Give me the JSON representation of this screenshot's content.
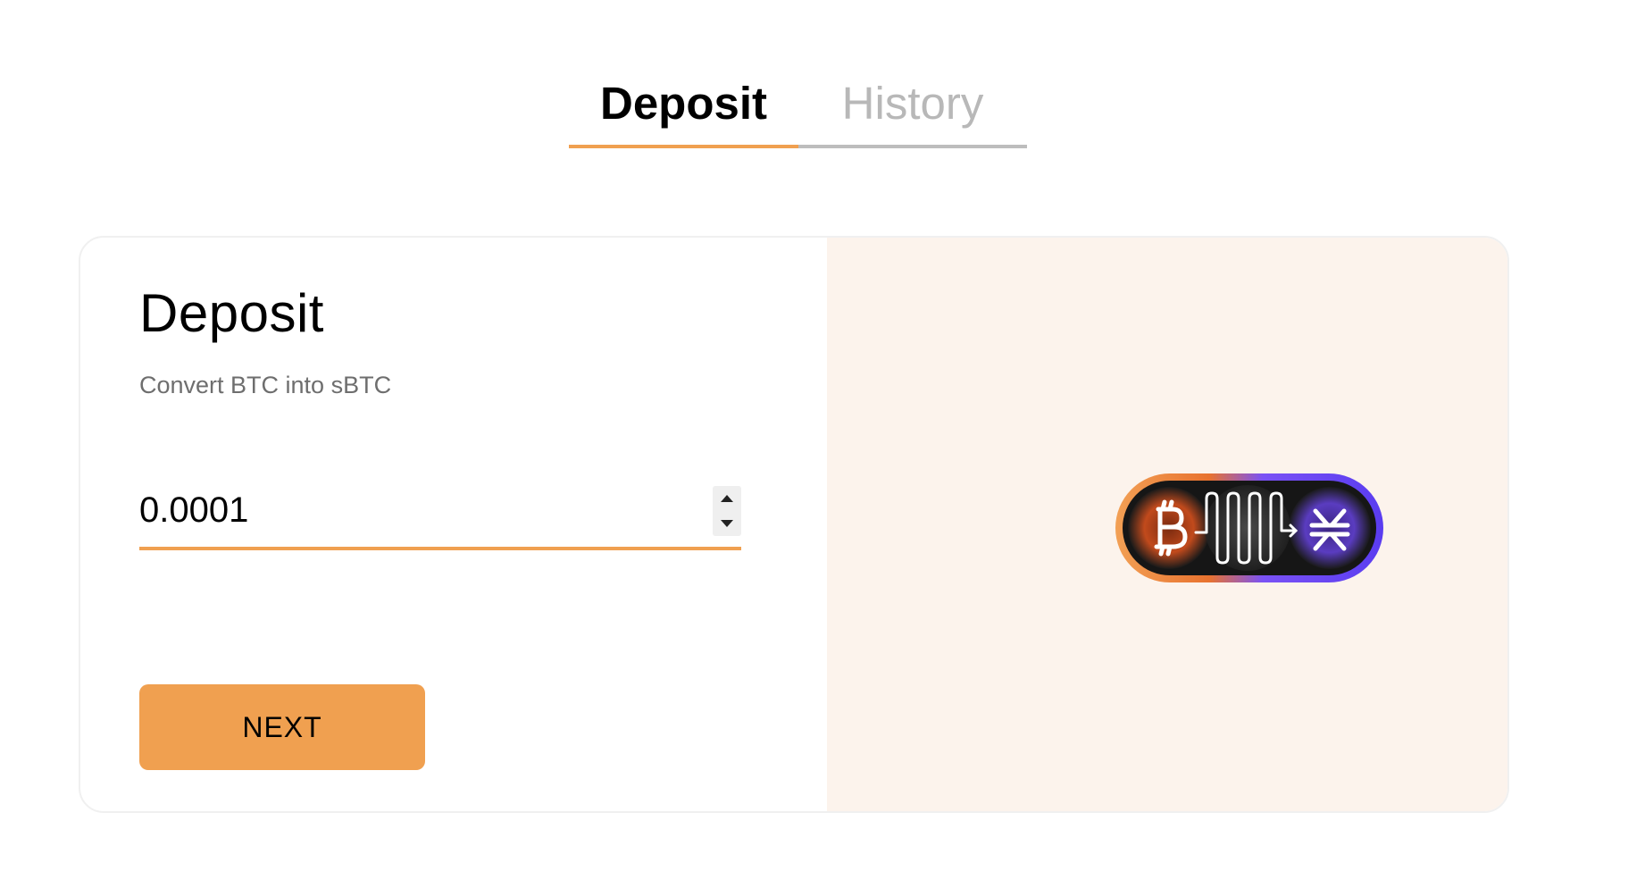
{
  "tabs": [
    {
      "label": "Deposit",
      "active": true
    },
    {
      "label": "History",
      "active": false
    }
  ],
  "deposit_form": {
    "title": "Deposit",
    "subtitle": "Convert BTC into sBTC",
    "amount_value": "0.0001",
    "next_label": "NEXT"
  },
  "graphic": {
    "icons": [
      "bitcoin-icon",
      "signal-wave-icon",
      "stacks-icon"
    ]
  },
  "colors": {
    "accent": "#f0a050",
    "tab_inactive": "#b8b8b8",
    "panel_bg": "#fcf3ec",
    "graphic_purple": "#6a4cf0",
    "graphic_orange": "#e8722f"
  }
}
